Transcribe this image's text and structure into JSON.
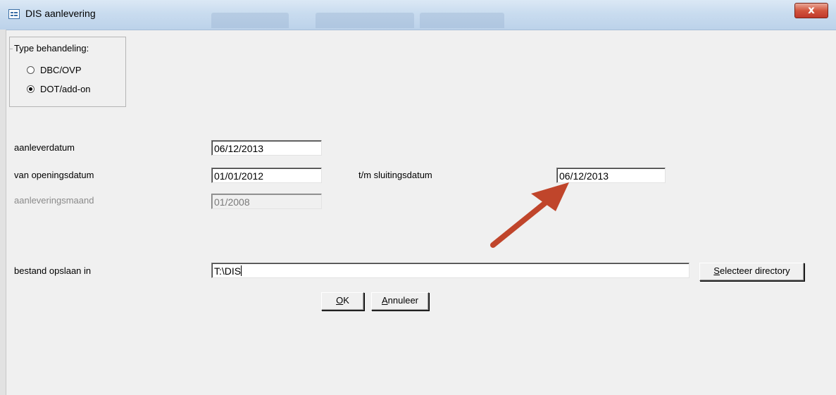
{
  "window": {
    "title": "DIS aanlevering",
    "close_symbol": "x"
  },
  "type_behandeling": {
    "legend": "Type behandeling:",
    "options": [
      {
        "label": "DBC/OVP",
        "checked": false
      },
      {
        "label": "DOT/add-on",
        "checked": true
      }
    ]
  },
  "fields": {
    "aanleverdatum": {
      "label": "aanleverdatum",
      "value": "06/12/2013"
    },
    "van_openingsdatum": {
      "label": "van openingsdatum",
      "value": "01/01/2012"
    },
    "tm_sluitingsdatum": {
      "label": "t/m sluitingsdatum",
      "value": "06/12/2013"
    },
    "aanleveringsmaand": {
      "label": "aanleveringsmaand",
      "value": "01/2008"
    },
    "bestand_opslaan": {
      "label": "bestand opslaan in",
      "value": "T:\\DIS"
    }
  },
  "buttons": {
    "select_dir_prefix": "S",
    "select_dir_rest": "electeer directory",
    "ok_prefix": "O",
    "ok_rest": "K",
    "cancel_prefix": "A",
    "cancel_rest": "nnuleer"
  },
  "annotation": {
    "arrow_color": "#c0452b"
  }
}
